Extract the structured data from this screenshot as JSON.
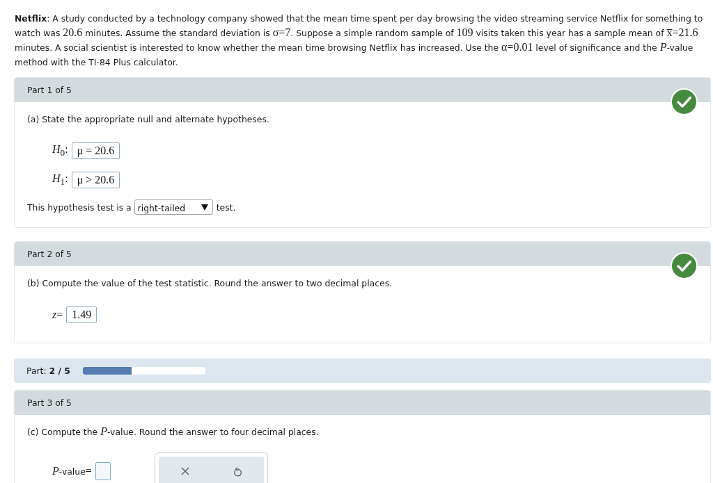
{
  "problem": {
    "runs": [
      {
        "kind": "text",
        "text": "**Netflix**: A study conducted by a technology company showed that the mean time spent per day browsing the video streaming service Netflix for something to watch was "
      },
      {
        "kind": "math",
        "text": "20.6"
      },
      {
        "kind": "text",
        "text": " minutes. Assume the standard deviation is "
      },
      {
        "kind": "math",
        "text": "σ=7"
      },
      {
        "kind": "text",
        "text": ". Suppose a simple random sample of "
      },
      {
        "kind": "math",
        "text": "109"
      },
      {
        "kind": "text",
        "text": " visits taken this year has a sample mean of "
      },
      {
        "kind": "math",
        "text": "x̅=21.6"
      },
      {
        "kind": "text",
        "text": " minutes. A social scientist is interested to know whether the mean time browsing Netflix has increased. Use the "
      },
      {
        "kind": "math",
        "text": "α=0.01"
      },
      {
        "kind": "text",
        "text": " level of significance and the "
      },
      {
        "kind": "math",
        "text": "*P*"
      },
      {
        "kind": "text",
        "text": "-value method with the TI-84 Plus calculator."
      }
    ]
  },
  "sections": [
    {
      "kind": "part",
      "header": "Part 1 of 5",
      "correct": true,
      "prompt": [
        {
          "kind": "text",
          "text": "(a) State the appropriate null and alternate hypotheses."
        }
      ],
      "items": [
        {
          "kind": "answer",
          "label": [
            {
              "kind": "math",
              "text": "*H*$_{0}$:"
            }
          ],
          "value": "μ = 20.6",
          "focused": false
        },
        {
          "kind": "answer",
          "label": [
            {
              "kind": "math",
              "text": "*H*$_{1}$:"
            }
          ],
          "value": "μ > 20.6",
          "focused": false
        },
        {
          "kind": "select",
          "before": "This hypothesis test is a",
          "value": "right-tailed",
          "after": "test."
        }
      ]
    },
    {
      "kind": "part",
      "header": "Part 2 of 5",
      "correct": true,
      "prompt": [
        {
          "kind": "text",
          "text": "(b) Compute the value of the test statistic. Round the answer to two decimal places."
        }
      ],
      "items": [
        {
          "kind": "answer",
          "label": [
            {
              "kind": "math",
              "text": "*z*="
            }
          ],
          "value": "1.49",
          "focused": false
        }
      ]
    },
    {
      "kind": "progress",
      "label": "Part: **2 / 5**",
      "level": 0.4
    },
    {
      "kind": "part",
      "header": "Part 3 of 5",
      "correct": false,
      "prompt": [
        {
          "kind": "text",
          "text": "(c) Compute the "
        },
        {
          "kind": "math",
          "text": "*P*"
        },
        {
          "kind": "text",
          "text": "-value. Round the answer to four decimal places."
        }
      ],
      "items": [
        {
          "kind": "answer",
          "label": [
            {
              "kind": "math",
              "text": "*P*"
            },
            {
              "kind": "text",
              "text": "-value"
            },
            {
              "kind": "math",
              "text": "="
            }
          ],
          "focused": true
        }
      ]
    }
  ]
}
